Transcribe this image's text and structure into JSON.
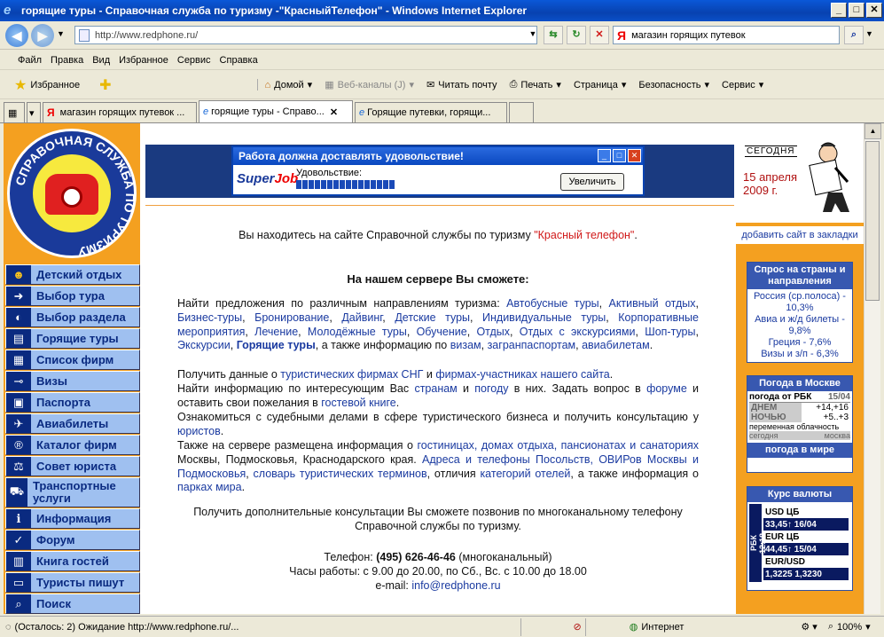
{
  "window": {
    "title": "горящие туры - Справочная служба по туризму -\"КрасныйТелефон\" - Windows Internet Explorer"
  },
  "address": {
    "url": "http://www.redphone.ru/",
    "search_value": "магазин горящих путевок"
  },
  "menu": [
    "Файл",
    "Правка",
    "Вид",
    "Избранное",
    "Сервис",
    "Справка"
  ],
  "favbar": {
    "favorites": "Избранное",
    "home": "Домой",
    "feeds": "Веб-каналы (J)",
    "mail": "Читать почту",
    "print": "Печать",
    "page": "Страница",
    "safety": "Безопасность",
    "tools": "Сервис"
  },
  "tabs": [
    "магазин горящих путевок ...",
    "горящие туры - Справо...",
    "Горящие путевки, горящи..."
  ],
  "status": {
    "text": "(Осталось: 2) Ожидание http://www.redphone.ru/...",
    "zone": "Интернет",
    "zoom": "100%"
  },
  "logo": {
    "text": "СПРАВОЧНАЯ СЛУЖБА ПО ТУРИЗМУ"
  },
  "nav": [
    {
      "label": "Детский отдых",
      "icon": "☻"
    },
    {
      "label": "Выбор тура",
      "icon": "➜"
    },
    {
      "label": "Выбор раздела",
      "icon": "◐"
    },
    {
      "label": "Горящие туры",
      "icon": "▤"
    },
    {
      "label": "Список фирм",
      "icon": "▦"
    },
    {
      "label": "Визы",
      "icon": "⊸"
    },
    {
      "label": "Паспорта",
      "icon": "▣"
    },
    {
      "label": "Авиабилеты",
      "icon": "✈"
    },
    {
      "label": "Каталог фирм",
      "icon": "®"
    },
    {
      "label": "Совет юриста",
      "icon": "⚖"
    },
    {
      "label": "Транспортные услуги",
      "icon": "⛟"
    },
    {
      "label": "Информация",
      "icon": "ℹ"
    },
    {
      "label": "Форум",
      "icon": "✓"
    },
    {
      "label": "Книга гостей",
      "icon": "▥"
    },
    {
      "label": "Туристы пишут",
      "icon": "▭"
    },
    {
      "label": "Поиск",
      "icon": "⌕"
    }
  ],
  "popup": {
    "title": "Работа должна доставлять удовольствие!",
    "brand_a": "Super",
    "brand_b": "Job",
    "progress_label": "Удовольствие:",
    "button": "Увеличить"
  },
  "intro": {
    "pre": "Вы находитесь на сайте Справочной службы по туризму ",
    "link": "\"Красный телефон\"",
    "post": "."
  },
  "heading": "На нашем сервере Вы сможете:",
  "p1": {
    "lead": "Найти предложения по различным направлениям туризма: ",
    "items": [
      "Автобусные туры",
      "Активный отдых",
      "Бизнес-туры",
      "Бронирование",
      "Дайвинг",
      "Детские туры",
      "Индивидуальные туры",
      "Корпоративные мероприятия",
      "Лечение",
      "Молодёжные туры",
      "Обучение",
      "Отдых",
      "Отдых с экскурсиями",
      "Шоп-туры",
      "Экскурсии",
      "Горящие туры"
    ],
    "tail": ", а также информацию по ",
    "info": [
      "визам",
      "загранпаспортам",
      "авиабилетам"
    ]
  },
  "p2": {
    "pre": "Получить данные о ",
    "l1": "туристических фирмах СНГ",
    "mid": " и ",
    "l2": "фирмах-участниках нашего сайта",
    "post": "."
  },
  "p3": {
    "pre": "Найти информацию по интересующим Вас ",
    "l1": "странам",
    "m1": " и ",
    "l2": "погоду",
    "m2": " в них. Задать вопрос в ",
    "l3": "форуме",
    "m3": " и оставить свои пожелания в ",
    "l4": "гостевой книге",
    "post": "."
  },
  "p4": {
    "pre": "Ознакомиться с судебными делами в сфере туристического бизнеса и получить консультацию у ",
    "l1": "юристов",
    "post": "."
  },
  "p5": {
    "pre": "Также на сервере размещена информация о ",
    "l1": "гостиницах, домах отдыха, пансионатах и санаториях",
    "m1": " Москвы, Подмосковья, Краснодарского края. ",
    "l2": "Адреса и телефоны Посольств, ОВИРов Москвы и Подмосковья",
    "m2": ", ",
    "l3": "словарь туристических терминов",
    "m3": ", отличия ",
    "l4": "категорий отелей",
    "m4": ", а также информация о ",
    "l5": "парках мира",
    "post": "."
  },
  "consult": "Получить дополнительные консультации Вы сможете позвонив по многоканальному телефону Справочной службы по туризму.",
  "contacts": {
    "phone_label": "Телефон: ",
    "phone": "(495) 626-46-46",
    "phone_note": " (многоканальный)",
    "hours": "Часы работы: с 9.00 до 20.00, по Сб., Вс. с 10.00 до 18.00",
    "email_label": "e-mail: ",
    "email": "info@redphone.ru"
  },
  "right": {
    "today_label": "СЕГОДНЯ",
    "date1": "15 апреля",
    "date2": "2009 г.",
    "bookmark": "добавить сайт в закладки",
    "demand_title": "Спрос на страны и направления",
    "demand": [
      "Россия (ср.полоса) - 10,3%",
      "Авиа и ж/д билеты - 9,8%",
      "Греция - 7,6%",
      "Визы и з/п - 6,3%"
    ],
    "weather_title": "Погода в Москве",
    "weather_src": "погода от РБК",
    "weather_date": "15/04",
    "day_lbl": "ДНЕМ",
    "day_val": "+14,+16",
    "night_lbl": "НОЧЬЮ",
    "night_val": "+5..+3",
    "weather_desc": "переменная облачность",
    "weather_today": "сегодня",
    "weather_city": "москва",
    "weather_world": "погода в мире",
    "currency_title": "Курс валюты",
    "cur_time": "12:18",
    "cur_src": "РБК",
    "usd_label": "USD ЦБ",
    "usd_val": "33,45↑ 16/04",
    "eur_label": "EUR ЦБ",
    "eur_val": "44,45↑ 15/04",
    "eurusd_label": "EUR/USD",
    "eurusd_val": "1,3225  1,3230"
  }
}
